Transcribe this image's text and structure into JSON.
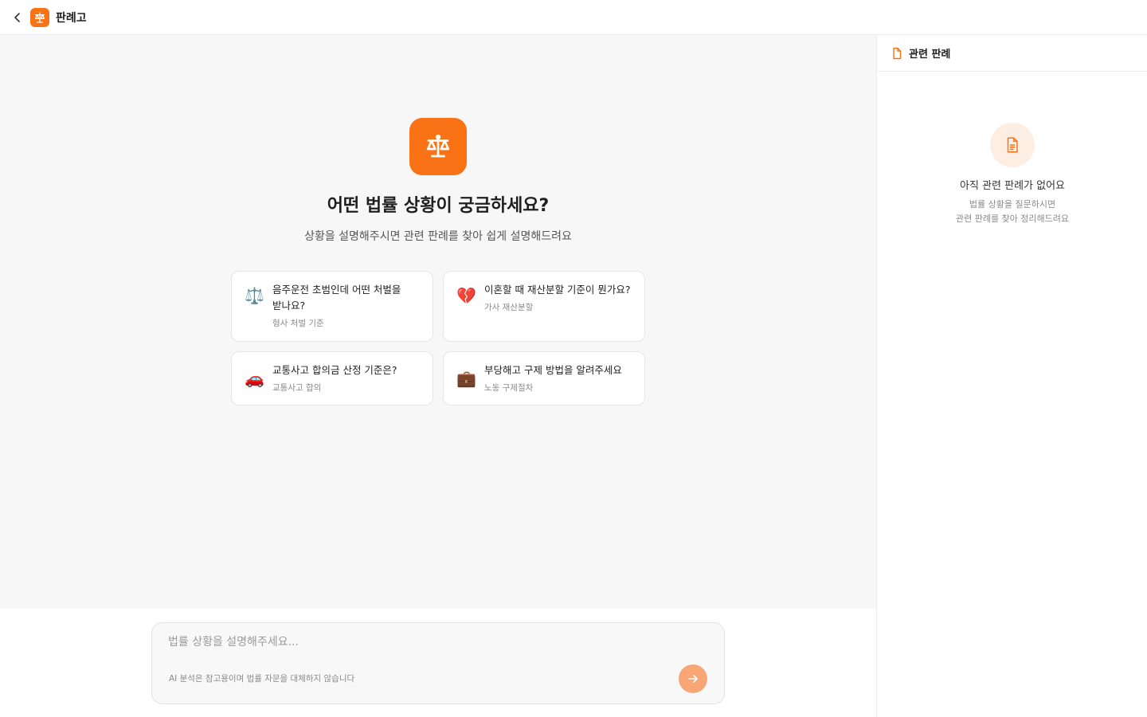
{
  "header": {
    "back_label": "뒤로",
    "app_name": "판례고"
  },
  "hero": {
    "title": "어떤 법률 상황이 궁금하세요?",
    "subtitle": "상황을 설명해주시면 관련 판례를 찾아 쉽게 설명해드려요"
  },
  "suggestions": [
    {
      "emoji": "⚖️",
      "question_line1": "음주운전 초범인데 어떤 처벌을",
      "question_line2": "받나요?",
      "category": "형사 처벌 기준",
      "icon": "scales-icon"
    },
    {
      "emoji": "💔",
      "question_line1": "이혼할 때 재산분할 기준이 뭔가요?",
      "question_line2": "",
      "category": "가사 재산분할",
      "icon": "broken-heart-icon"
    },
    {
      "emoji": "🚗",
      "question_line1": "교통사고 합의금 산정 기준은?",
      "question_line2": "",
      "category": "교통사고 합의",
      "icon": "car-icon"
    },
    {
      "emoji": "💼",
      "question_line1": "부당해고 구제 방법을 알려주세요",
      "question_line2": "",
      "category": "노동 구제절차",
      "icon": "briefcase-icon"
    }
  ],
  "composer": {
    "placeholder": "법률 상황을 설명해주세요...",
    "disclaimer": "AI 분석은 참고용이며 법률 자문을 대체하지 않습니다",
    "send_icon": "arrow-right-icon"
  },
  "sidebar": {
    "title": "관련 판례",
    "empty_title": "아직 관련 판례가 없어요",
    "empty_desc_line1": "법률 상황을 질문하시면",
    "empty_desc_line2": "관련 판례를 찾아 정리해드려요"
  },
  "colors": {
    "brand": "#f97316",
    "send_button": "#f9a677",
    "empty_icon_bg": "#fdeee4"
  }
}
